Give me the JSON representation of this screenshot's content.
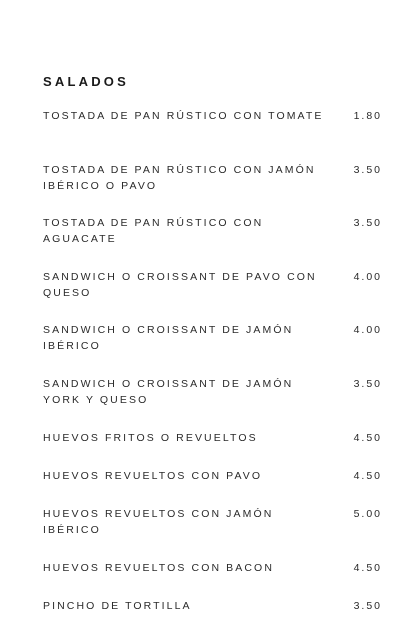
{
  "section": {
    "title": "SALADOS"
  },
  "items": [
    {
      "name": "TOSTADA DE PAN RÚSTICO CON TOMATE",
      "price": "1.80"
    },
    {
      "name": "TOSTADA DE PAN RÚSTICO CON JAMÓN IBÉRICO O PAVO",
      "price": "3.50"
    },
    {
      "name": "TOSTADA DE PAN RÚSTICO CON AGUACATE",
      "price": "3.50"
    },
    {
      "name": "SANDWICH O CROISSANT DE PAVO CON QUESO",
      "price": "4.00"
    },
    {
      "name": "SANDWICH O CROISSANT DE JAMÓN IBÉRICO",
      "price": "4.00"
    },
    {
      "name": "SANDWICH O CROISSANT DE JAMÓN YORK Y QUESO",
      "price": "3.50"
    },
    {
      "name": "HUEVOS FRITOS O REVUELTOS",
      "price": "4.50"
    },
    {
      "name": "HUEVOS REVUELTOS CON PAVO",
      "price": "4.50"
    },
    {
      "name": "HUEVOS REVUELTOS CON JAMÓN IBÉRICO",
      "price": "5.00"
    },
    {
      "name": "HUEVOS REVUELTOS CON BACON",
      "price": "4.50"
    },
    {
      "name": "PINCHO DE TORTILLA",
      "price": "3.50"
    }
  ]
}
